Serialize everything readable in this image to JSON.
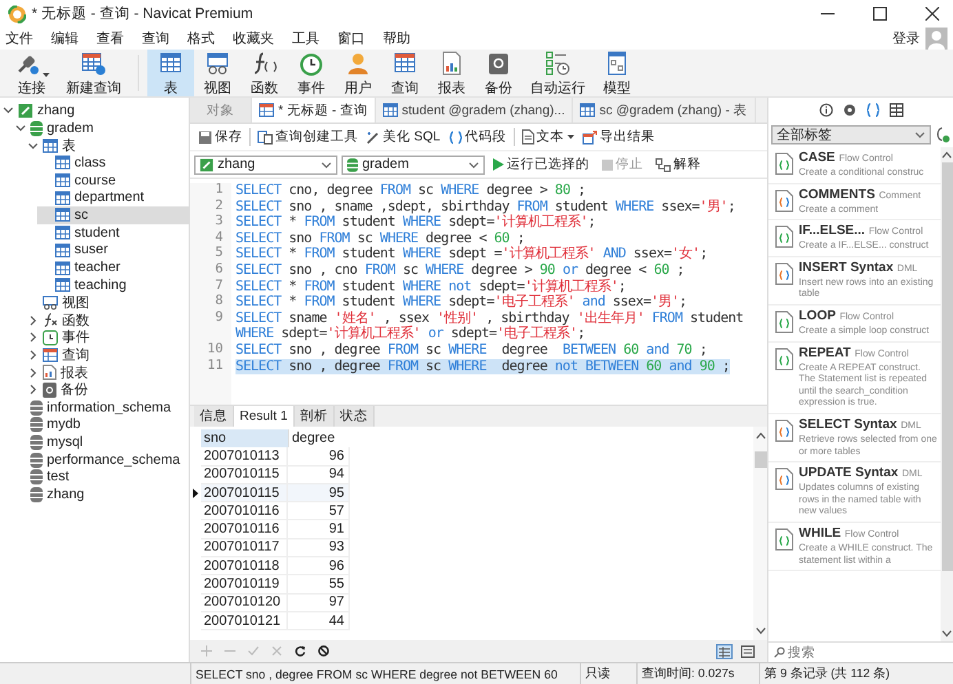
{
  "window": {
    "title": "* 无标题 - 查询 - Navicat Premium"
  },
  "menu": [
    "文件",
    "编辑",
    "查看",
    "查询",
    "格式",
    "收藏夹",
    "工具",
    "窗口",
    "帮助"
  ],
  "login": "登录",
  "toolbar": [
    {
      "label": "连接",
      "selected": false,
      "dropdown": true
    },
    {
      "label": "新建查询",
      "selected": false,
      "dropdown": false
    },
    {
      "label": "表",
      "selected": true,
      "dropdown": false
    },
    {
      "label": "视图",
      "selected": false,
      "dropdown": false
    },
    {
      "label": "函数",
      "selected": false,
      "dropdown": false
    },
    {
      "label": "事件",
      "selected": false,
      "dropdown": false
    },
    {
      "label": "用户",
      "selected": false,
      "dropdown": false
    },
    {
      "label": "查询",
      "selected": false,
      "dropdown": false
    },
    {
      "label": "报表",
      "selected": false,
      "dropdown": false
    },
    {
      "label": "备份",
      "selected": false,
      "dropdown": false
    },
    {
      "label": "自动运行",
      "selected": false,
      "dropdown": false
    },
    {
      "label": "模型",
      "selected": false,
      "dropdown": false
    }
  ],
  "sidebar": {
    "tree": [
      {
        "label": "zhang",
        "kind": "connection",
        "expanded": true,
        "selected": false,
        "children": [
          {
            "label": "gradem",
            "kind": "database",
            "expanded": true,
            "selected": false,
            "children": [
              {
                "label": "表",
                "kind": "tables",
                "expanded": true,
                "selected": false,
                "children": [
                  {
                    "label": "class",
                    "kind": "table",
                    "selected": false
                  },
                  {
                    "label": "course",
                    "kind": "table",
                    "selected": false
                  },
                  {
                    "label": "department",
                    "kind": "table",
                    "selected": false
                  },
                  {
                    "label": "sc",
                    "kind": "table",
                    "selected": true
                  },
                  {
                    "label": "student",
                    "kind": "table",
                    "selected": false
                  },
                  {
                    "label": "suser",
                    "kind": "table",
                    "selected": false
                  },
                  {
                    "label": "teacher",
                    "kind": "table",
                    "selected": false
                  },
                  {
                    "label": "teaching",
                    "kind": "table",
                    "selected": false
                  }
                ]
              },
              {
                "label": "视图",
                "kind": "views",
                "selected": false
              },
              {
                "label": "函数",
                "kind": "functions",
                "expanded": false,
                "selected": false
              },
              {
                "label": "事件",
                "kind": "events",
                "expanded": false,
                "selected": false
              },
              {
                "label": "查询",
                "kind": "queries",
                "expanded": false,
                "selected": false
              },
              {
                "label": "报表",
                "kind": "reports",
                "expanded": false,
                "selected": false
              },
              {
                "label": "备份",
                "kind": "backups",
                "expanded": false,
                "selected": false
              }
            ]
          },
          {
            "label": "information_schema",
            "kind": "database-closed",
            "selected": false
          },
          {
            "label": "mydb",
            "kind": "database-closed",
            "selected": false
          },
          {
            "label": "mysql",
            "kind": "database-closed",
            "selected": false
          },
          {
            "label": "performance_schema",
            "kind": "database-closed",
            "selected": false
          },
          {
            "label": "test",
            "kind": "database-closed",
            "selected": false
          },
          {
            "label": "zhang",
            "kind": "database-closed",
            "selected": false
          }
        ]
      }
    ]
  },
  "doc_tabs": [
    {
      "label": "对象",
      "kind": "plain",
      "selected": false
    },
    {
      "label": "* 无标题 - 查询",
      "kind": "query",
      "selected": true
    },
    {
      "label": "student @gradem (zhang)...",
      "kind": "table",
      "selected": false
    },
    {
      "label": "sc @gradem (zhang) - 表",
      "kind": "table",
      "selected": false
    }
  ],
  "query_toolbar": [
    {
      "label": "保存",
      "kind": "save"
    },
    {
      "label": "查询创建工具",
      "kind": "builder"
    },
    {
      "label": "美化 SQL",
      "kind": "beautify"
    },
    {
      "label": "代码段",
      "kind": "snippet"
    },
    {
      "label": "文本",
      "kind": "text"
    },
    {
      "label": "导出结果",
      "kind": "export"
    }
  ],
  "connection_select": "zhang",
  "database_select": "gradem",
  "run_button": {
    "label": "运行已选择的",
    "disabled": false
  },
  "stop_button": {
    "label": "停止",
    "disabled": true
  },
  "explain_button": {
    "label": "解释",
    "disabled": false
  },
  "editor": {
    "lines": [
      {
        "number": "1",
        "selected": false,
        "tokens": [
          {
            "kind": "keyword",
            "text": "SELECT"
          },
          {
            "kind": "plain",
            "text": " cno, degree "
          },
          {
            "kind": "keyword",
            "text": "FROM"
          },
          {
            "kind": "plain",
            "text": " sc "
          },
          {
            "kind": "keyword",
            "text": "WHERE"
          },
          {
            "kind": "plain",
            "text": " degree > "
          },
          {
            "kind": "number",
            "text": "80"
          },
          {
            "kind": "plain",
            "text": " ;"
          }
        ]
      },
      {
        "number": "2",
        "selected": false,
        "tokens": [
          {
            "kind": "keyword",
            "text": "SELECT"
          },
          {
            "kind": "plain",
            "text": " sno , sname ,sdept, sbirthday "
          },
          {
            "kind": "keyword",
            "text": "FROM"
          },
          {
            "kind": "plain",
            "text": " student "
          },
          {
            "kind": "keyword",
            "text": "WHERE"
          },
          {
            "kind": "plain",
            "text": " ssex="
          },
          {
            "kind": "string",
            "text": "'男'"
          },
          {
            "kind": "plain",
            "text": ";"
          }
        ]
      },
      {
        "number": "3",
        "selected": false,
        "tokens": [
          {
            "kind": "keyword",
            "text": "SELECT"
          },
          {
            "kind": "plain",
            "text": " * "
          },
          {
            "kind": "keyword",
            "text": "FROM"
          },
          {
            "kind": "plain",
            "text": " student "
          },
          {
            "kind": "keyword",
            "text": "WHERE"
          },
          {
            "kind": "plain",
            "text": " sdept="
          },
          {
            "kind": "string",
            "text": "'计算机工程系'"
          },
          {
            "kind": "plain",
            "text": ";"
          }
        ]
      },
      {
        "number": "4",
        "selected": false,
        "tokens": [
          {
            "kind": "keyword",
            "text": "SELECT"
          },
          {
            "kind": "plain",
            "text": " sno "
          },
          {
            "kind": "keyword",
            "text": "FROM"
          },
          {
            "kind": "plain",
            "text": " sc "
          },
          {
            "kind": "keyword",
            "text": "WHERE"
          },
          {
            "kind": "plain",
            "text": " degree < "
          },
          {
            "kind": "number",
            "text": "60"
          },
          {
            "kind": "plain",
            "text": " ;"
          }
        ]
      },
      {
        "number": "5",
        "selected": false,
        "tokens": [
          {
            "kind": "keyword",
            "text": "SELECT"
          },
          {
            "kind": "plain",
            "text": " * "
          },
          {
            "kind": "keyword",
            "text": "FROM"
          },
          {
            "kind": "plain",
            "text": " student "
          },
          {
            "kind": "keyword",
            "text": "WHERE"
          },
          {
            "kind": "plain",
            "text": " sdept ="
          },
          {
            "kind": "string",
            "text": "'计算机工程系'"
          },
          {
            "kind": "keyword",
            "text": " AND"
          },
          {
            "kind": "plain",
            "text": " ssex="
          },
          {
            "kind": "string",
            "text": "'女'"
          },
          {
            "kind": "plain",
            "text": ";"
          }
        ]
      },
      {
        "number": "6",
        "selected": false,
        "tokens": [
          {
            "kind": "keyword",
            "text": "SELECT"
          },
          {
            "kind": "plain",
            "text": " sno , cno "
          },
          {
            "kind": "keyword",
            "text": "FROM"
          },
          {
            "kind": "plain",
            "text": " sc "
          },
          {
            "kind": "keyword",
            "text": "WHERE"
          },
          {
            "kind": "plain",
            "text": " degree > "
          },
          {
            "kind": "number",
            "text": "90"
          },
          {
            "kind": "keyword",
            "text": " or"
          },
          {
            "kind": "plain",
            "text": " degree < "
          },
          {
            "kind": "number",
            "text": "60"
          },
          {
            "kind": "plain",
            "text": " ;"
          }
        ]
      },
      {
        "number": "7",
        "selected": false,
        "tokens": [
          {
            "kind": "keyword",
            "text": "SELECT"
          },
          {
            "kind": "plain",
            "text": " * "
          },
          {
            "kind": "keyword",
            "text": "FROM"
          },
          {
            "kind": "plain",
            "text": " student "
          },
          {
            "kind": "keyword",
            "text": "WHERE"
          },
          {
            "kind": "keyword",
            "text": " not"
          },
          {
            "kind": "plain",
            "text": " sdept="
          },
          {
            "kind": "string",
            "text": "'计算机工程系'"
          },
          {
            "kind": "plain",
            "text": ";"
          }
        ]
      },
      {
        "number": "8",
        "selected": false,
        "tokens": [
          {
            "kind": "keyword",
            "text": "SELECT"
          },
          {
            "kind": "plain",
            "text": " * "
          },
          {
            "kind": "keyword",
            "text": "FROM"
          },
          {
            "kind": "plain",
            "text": " student "
          },
          {
            "kind": "keyword",
            "text": "WHERE"
          },
          {
            "kind": "plain",
            "text": " sdept="
          },
          {
            "kind": "string",
            "text": "'电子工程系'"
          },
          {
            "kind": "keyword",
            "text": " and"
          },
          {
            "kind": "plain",
            "text": " ssex="
          },
          {
            "kind": "string",
            "text": "'男'"
          },
          {
            "kind": "plain",
            "text": ";"
          }
        ]
      },
      {
        "number": "9",
        "selected": false,
        "tokens": [
          {
            "kind": "keyword",
            "text": "SELECT"
          },
          {
            "kind": "plain",
            "text": " sname "
          },
          {
            "kind": "string",
            "text": "'姓名'"
          },
          {
            "kind": "plain",
            "text": " , ssex "
          },
          {
            "kind": "string",
            "text": "'性别'"
          },
          {
            "kind": "plain",
            "text": " , sbirthday "
          },
          {
            "kind": "string",
            "text": "'出生年月'"
          },
          {
            "kind": "keyword",
            "text": " FROM"
          },
          {
            "kind": "plain",
            "text": " student "
          },
          {
            "kind": "keyword",
            "text": "WHERE"
          },
          {
            "kind": "plain",
            "text": " sdept="
          },
          {
            "kind": "string",
            "text": "'计算机工程系'"
          },
          {
            "kind": "keyword",
            "text": " or"
          },
          {
            "kind": "plain",
            "text": " sdept="
          },
          {
            "kind": "string",
            "text": "'电子工程系'"
          },
          {
            "kind": "plain",
            "text": ";"
          }
        ]
      },
      {
        "number": "10",
        "selected": false,
        "tokens": [
          {
            "kind": "keyword",
            "text": "SELECT"
          },
          {
            "kind": "plain",
            "text": " sno , degree "
          },
          {
            "kind": "keyword",
            "text": "FROM"
          },
          {
            "kind": "plain",
            "text": " sc "
          },
          {
            "kind": "keyword",
            "text": "WHERE"
          },
          {
            "kind": "plain",
            "text": "  degree  "
          },
          {
            "kind": "keyword",
            "text": "BETWEEN"
          },
          {
            "kind": "number",
            "text": " 60"
          },
          {
            "kind": "keyword",
            "text": " and"
          },
          {
            "kind": "number",
            "text": " 70"
          },
          {
            "kind": "plain",
            "text": " ;"
          }
        ]
      },
      {
        "number": "11",
        "selected": true,
        "tokens": [
          {
            "kind": "keyword",
            "text": "SELECT"
          },
          {
            "kind": "plain",
            "text": " sno , degree "
          },
          {
            "kind": "keyword",
            "text": "FROM"
          },
          {
            "kind": "plain",
            "text": " sc "
          },
          {
            "kind": "keyword",
            "text": "WHERE"
          },
          {
            "kind": "plain",
            "text": "  degree "
          },
          {
            "kind": "keyword",
            "text": "not BETWEEN"
          },
          {
            "kind": "number",
            "text": " 60"
          },
          {
            "kind": "keyword",
            "text": " and"
          },
          {
            "kind": "number",
            "text": " 90"
          },
          {
            "kind": "plain",
            "text": " ;"
          }
        ]
      }
    ]
  },
  "result_tabs": [
    {
      "label": "信息",
      "selected": false
    },
    {
      "label": "Result 1",
      "selected": true
    },
    {
      "label": "剖析",
      "selected": false
    },
    {
      "label": "状态",
      "selected": false
    }
  ],
  "grid": {
    "columns": [
      "sno",
      "degree"
    ],
    "rows": [
      {
        "cells": [
          "2007010113",
          "96"
        ],
        "current": false
      },
      {
        "cells": [
          "2007010115",
          "94"
        ],
        "current": false
      },
      {
        "cells": [
          "2007010115",
          "95"
        ],
        "current": true
      },
      {
        "cells": [
          "2007010116",
          "57"
        ],
        "current": false
      },
      {
        "cells": [
          "2007010116",
          "91"
        ],
        "current": false
      },
      {
        "cells": [
          "2007010117",
          "93"
        ],
        "current": false
      },
      {
        "cells": [
          "2007010118",
          "96"
        ],
        "current": false
      },
      {
        "cells": [
          "2007010119",
          "55"
        ],
        "current": false
      },
      {
        "cells": [
          "2007010120",
          "97"
        ],
        "current": false
      },
      {
        "cells": [
          "2007010121",
          "44"
        ],
        "current": false
      }
    ]
  },
  "right_panel": {
    "view_buttons": [
      {
        "selected": false
      },
      {
        "selected": false
      },
      {
        "selected": true
      },
      {
        "selected": false
      }
    ],
    "tag_select": "全部标签",
    "snippets": [
      {
        "name": "CASE",
        "category": "Flow Control",
        "description": "Create a conditional construc",
        "kind": "flow"
      },
      {
        "name": "COMMENTS",
        "category": "Comment",
        "description": "Create a comment",
        "kind": "general"
      },
      {
        "name": "IF...ELSE...",
        "category": "Flow Control",
        "description": "Create a IF...ELSE... construct",
        "kind": "flow"
      },
      {
        "name": "INSERT Syntax",
        "category": "DML",
        "description": "Insert new rows into an existing table",
        "kind": "general"
      },
      {
        "name": "LOOP",
        "category": "Flow Control",
        "description": "Create a simple loop construct",
        "kind": "flow"
      },
      {
        "name": "REPEAT",
        "category": "Flow Control",
        "description": "Create A REPEAT construct. The Statement list is repeated until the search_condition expression is true.",
        "kind": "flow"
      },
      {
        "name": "SELECT Syntax",
        "category": "DML",
        "description": "Retrieve rows selected from one or more tables",
        "kind": "general"
      },
      {
        "name": "UPDATE Syntax",
        "category": "DML",
        "description": "Updates columns of existing rows in the named table with new values",
        "kind": "general"
      },
      {
        "name": "WHILE",
        "category": "Flow Control",
        "description": "Create a WHILE construct. The statement list within a",
        "kind": "flow"
      }
    ],
    "search_placeholder": "搜索"
  },
  "status_bar": {
    "sql": "SELECT sno , degree FROM sc WHERE degree not BETWEEN 60",
    "mode": "只读",
    "query_time": "查询时间: 0.027s",
    "record": "第 9 条记录 (共 112 条)"
  }
}
